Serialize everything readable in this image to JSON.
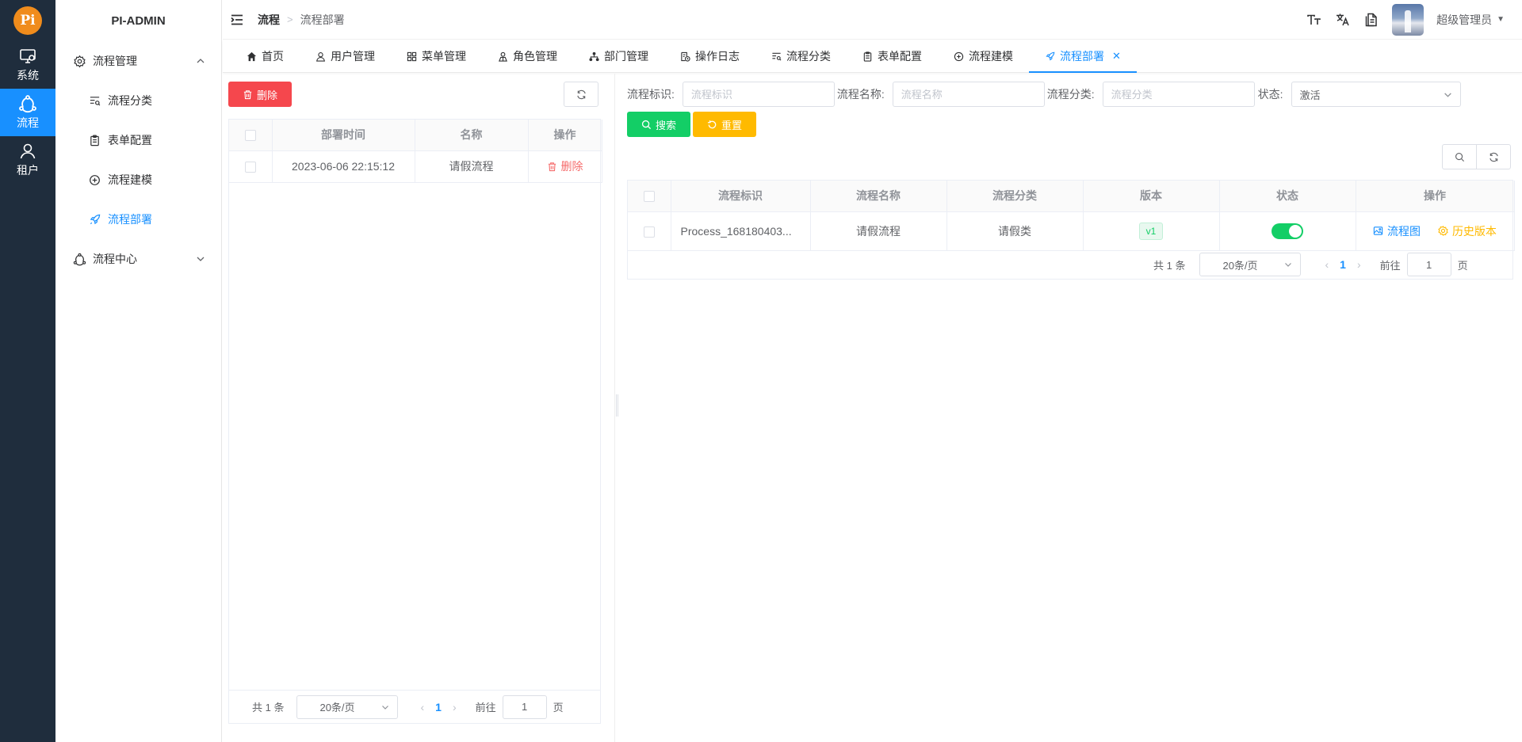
{
  "rail": {
    "logo_text": "Pi",
    "items": [
      {
        "label": "系统",
        "icon": "monitor-icon"
      },
      {
        "label": "流程",
        "icon": "flow-icon"
      },
      {
        "label": "租户",
        "icon": "user-icon"
      }
    ]
  },
  "menu": {
    "title": "PI-ADMIN",
    "group1": "流程管理",
    "subs": [
      "流程分类",
      "表单配置",
      "流程建模",
      "流程部署"
    ],
    "group2": "流程中心"
  },
  "header": {
    "crumb_root": "流程",
    "crumb_sep": ">",
    "crumb_current": "流程部署",
    "user_name": "超级管理员"
  },
  "tabs": [
    "首页",
    "用户管理",
    "菜单管理",
    "角色管理",
    "部门管理",
    "操作日志",
    "流程分类",
    "表单配置",
    "流程建模",
    "流程部署"
  ],
  "left": {
    "delete_btn": "删除",
    "columns": [
      "部署时间",
      "名称",
      "操作"
    ],
    "rows": [
      {
        "time": "2023-06-06 22:15:12",
        "name": "请假流程",
        "action": "删除"
      }
    ],
    "pager": {
      "total": "共 1 条",
      "size": "20条/页",
      "page": "1",
      "goto": "前往",
      "goto_value": "1",
      "unit": "页"
    }
  },
  "right": {
    "filters": {
      "key_label": "流程标识:",
      "key_placeholder": "流程标识",
      "name_label": "流程名称:",
      "name_placeholder": "流程名称",
      "cat_label": "流程分类:",
      "cat_placeholder": "流程分类",
      "status_label": "状态:",
      "status_value": "激活"
    },
    "search_btn": "搜索",
    "reset_btn": "重置",
    "columns": [
      "流程标识",
      "流程名称",
      "流程分类",
      "版本",
      "状态",
      "操作"
    ],
    "rows": [
      {
        "key": "Process_168180403...",
        "name": "请假流程",
        "category": "请假类",
        "version": "v1",
        "status_on": true,
        "action1": "流程图",
        "action2": "历史版本"
      }
    ],
    "pager": {
      "total": "共 1 条",
      "size": "20条/页",
      "page": "1",
      "goto": "前往",
      "goto_value": "1",
      "unit": "页"
    }
  },
  "colors": {
    "primary": "#1890ff",
    "danger": "#f5474d",
    "success": "#13ce66",
    "warning": "#ffba00",
    "rail": "#1f2d3d"
  }
}
